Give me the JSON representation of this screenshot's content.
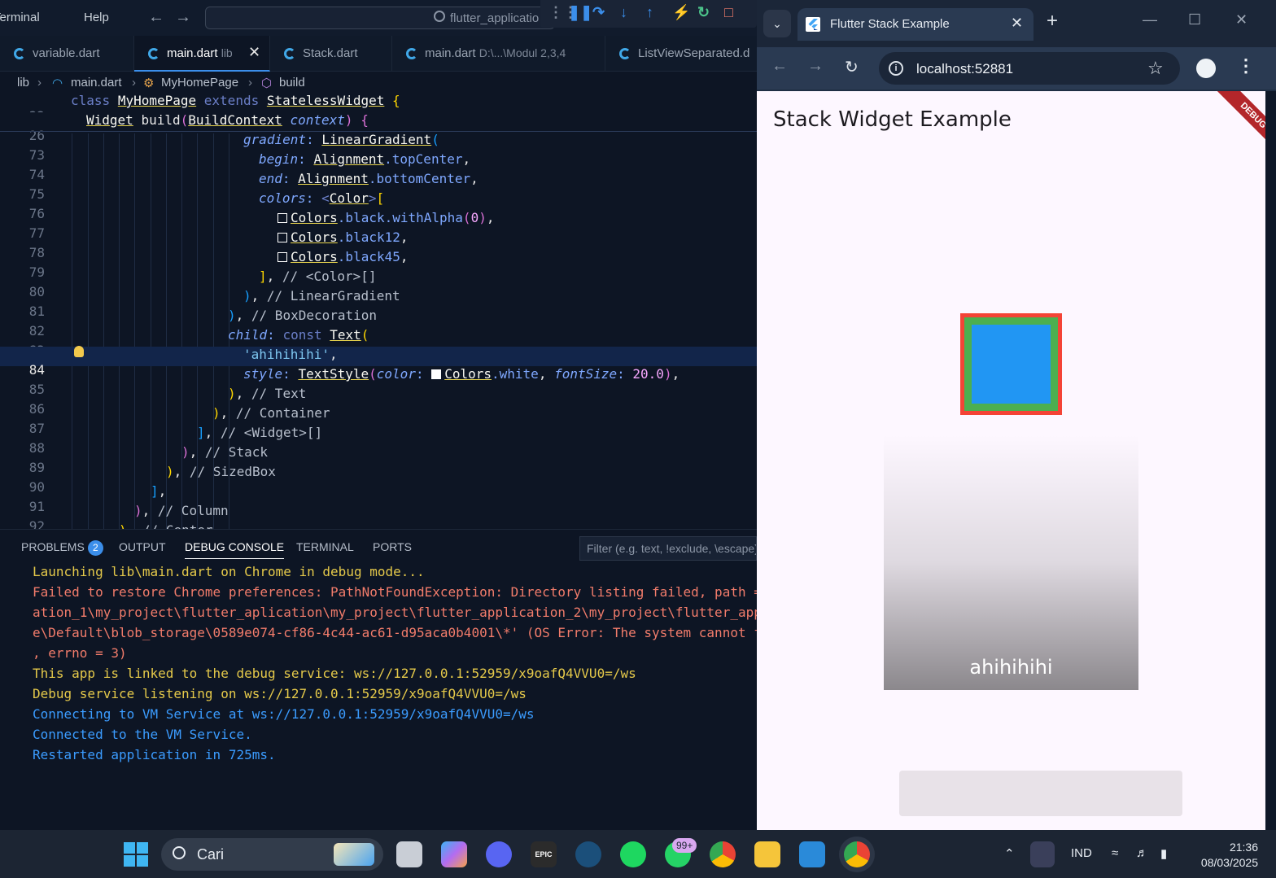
{
  "vscode": {
    "menu": [
      "Terminal",
      "Help"
    ],
    "command_center": "flutter_applicatio",
    "tabs": [
      {
        "name": "variable.dart",
        "desc": "",
        "active": false
      },
      {
        "name": "main.dart",
        "desc": "lib",
        "active": true
      },
      {
        "name": "Stack.dart",
        "desc": "",
        "active": false
      },
      {
        "name": "main.dart",
        "desc": "D:\\...\\Modul 2,3,4",
        "active": false
      },
      {
        "name": "ListViewSeparated.d",
        "desc": "",
        "active": false
      }
    ],
    "breadcrumb": [
      "lib",
      "main.dart",
      "MyHomePage",
      "build"
    ],
    "line_numbers": [
      "22",
      "26",
      "73",
      "74",
      "75",
      "76",
      "77",
      "78",
      "79",
      "80",
      "81",
      "82",
      "83",
      "84",
      "85",
      "86",
      "87",
      "88",
      "89",
      "90",
      "91",
      "92",
      "93"
    ],
    "code": {
      "l22": {
        "kw1": "class",
        "cls1": "MyHomePage",
        "kw2": "extends",
        "cls2": "StatelessWidget",
        "br": "{"
      },
      "l26": {
        "cls1": "Widget",
        "fn": "build",
        "cls2": "BuildContext",
        "prop": "context",
        "br": "{"
      },
      "l73": {
        "prop": "gradient",
        "cls": "LinearGradient"
      },
      "l74": {
        "prop": "begin",
        "cls": "Alignment",
        "member": ".topCenter"
      },
      "l75": {
        "prop": "end",
        "cls": "Alignment",
        "member": ".bottomCenter"
      },
      "l76": {
        "prop": "colors",
        "cls": "Color"
      },
      "l77": {
        "cls": "Colors",
        "member": ".black.withAlpha",
        "num": "0"
      },
      "l78": {
        "cls": "Colors",
        "member": ".black12"
      },
      "l79": {
        "cls": "Colors",
        "member": ".black45"
      },
      "l80": {
        "cmt": "// <Color>[]"
      },
      "l81": {
        "cmt": "// LinearGradient"
      },
      "l82": {
        "cmt": "// BoxDecoration"
      },
      "l83": {
        "prop": "child",
        "kw": "const",
        "cls": "Text"
      },
      "l84": {
        "str": "'ahihihihi'"
      },
      "l85": {
        "prop1": "style",
        "cls1": "TextStyle",
        "prop2": "color",
        "cls2": "Colors",
        "member": ".white",
        "prop3": "fontSize",
        "num": "20.0"
      },
      "l86": {
        "cmt": "// Text"
      },
      "l87": {
        "cmt": "// Container"
      },
      "l88": {
        "cmt": "// <Widget>[]"
      },
      "l89": {
        "cmt": "// Stack"
      },
      "l90": {
        "cmt": "// SizedBox"
      },
      "l92": {
        "cmt": "// Column"
      },
      "l93": {
        "cmt": "// Center"
      }
    },
    "panel": {
      "tabs": [
        "PROBLEMS",
        "OUTPUT",
        "DEBUG CONSOLE",
        "TERMINAL",
        "PORTS"
      ],
      "problems_count": "2",
      "filter_placeholder": "Filter (e.g. text, !exclude, \\escape)",
      "console_lines": [
        {
          "text": "Launching lib\\main.dart on Chrome in debug mode...",
          "color": "yellow"
        },
        {
          "text": "Failed to restore Chrome preferences: PathNotFoundException: Directory listing failed, path =",
          "color": "red"
        },
        {
          "text": "ation_1\\my_project\\flutter_aplication\\my_project\\flutter_application_2\\my_project\\flutter_app",
          "color": "red"
        },
        {
          "text": "e\\Default\\blob_storage\\0589e074-cf86-4c44-ac61-d95aca0b4001\\*' (OS Error: The system cannot f",
          "color": "red"
        },
        {
          "text": ", errno = 3)",
          "color": "red"
        },
        {
          "text": "This app is linked to the debug service: ws://127.0.0.1:52959/x9oafQ4VVU0=/ws",
          "color": "yellow"
        },
        {
          "text": "Debug service listening on ws://127.0.0.1:52959/x9oafQ4VVU0=/ws",
          "color": "yellow"
        },
        {
          "text": "Connecting to VM Service at ws://127.0.0.1:52959/x9oafQ4VVU0=/ws",
          "color": "blue"
        },
        {
          "text": "Connected to the VM Service.",
          "color": "blue"
        },
        {
          "text": "Restarted application in 725ms.",
          "color": "blue"
        }
      ]
    }
  },
  "chrome": {
    "tab_title": "Flutter Stack Example",
    "url": "localhost:52881",
    "app": {
      "title": "Stack Widget Example",
      "debug_banner": "DEBUG",
      "gradient_text": "ahihihihi",
      "colors": {
        "outer": "#f44336",
        "middle": "#4caf50",
        "inner": "#2196f3"
      }
    }
  },
  "taskbar": {
    "search_label": "Cari",
    "badge": "99+",
    "language": "IND",
    "time": "21:36",
    "date": "08/03/2025"
  }
}
